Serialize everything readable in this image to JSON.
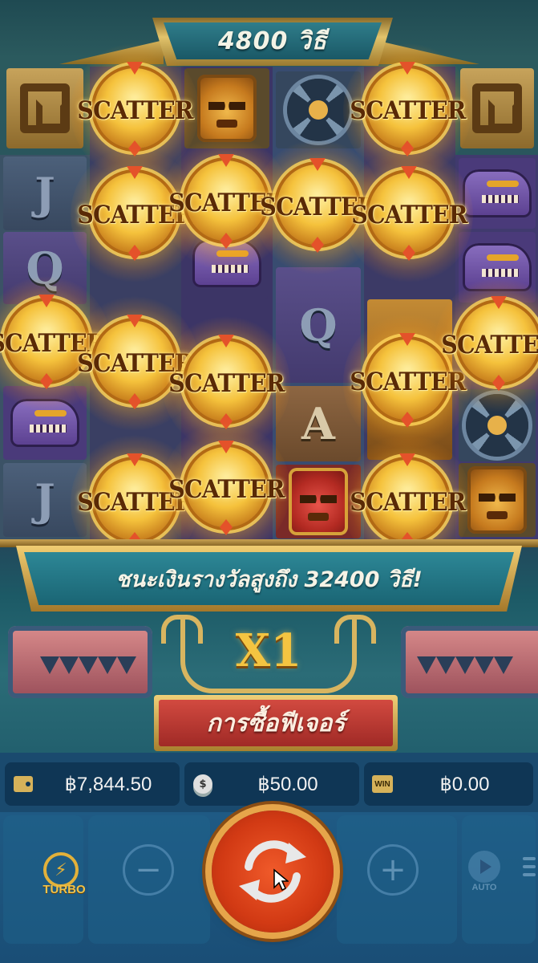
{
  "header": {
    "ways_text": "4800 วิธี"
  },
  "reels": {
    "letters": {
      "j": "J",
      "q": "Q",
      "a": "A"
    },
    "scatter_label": "SCATTER"
  },
  "banner": {
    "win_text": "ชนะเงินรางวัลสูงถึง 32400 วิธี!"
  },
  "multiplier": {
    "value": "X1"
  },
  "feature_button": {
    "label": "การซื้อฟีเจอร์"
  },
  "stats": {
    "balance": "฿7,844.50",
    "bet": "฿50.00",
    "win_icon_text": "WIN",
    "win": "฿0.00"
  },
  "controls": {
    "turbo_label": "TURBO",
    "minus_symbol": "−",
    "plus_symbol": "+",
    "auto_label": "AUTO"
  },
  "colors": {
    "gold": "#e2b13a",
    "spin_red": "#d23a14",
    "panel_teal": "#1a6574",
    "feature_red": "#a02a26"
  }
}
